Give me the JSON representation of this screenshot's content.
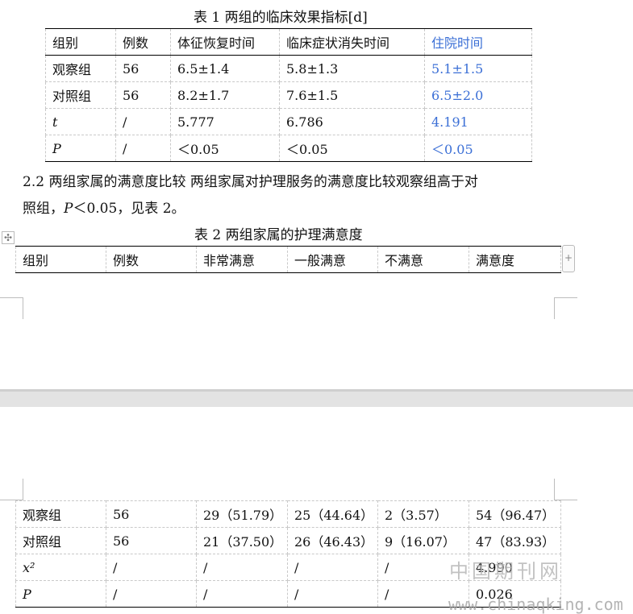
{
  "table1": {
    "caption": "表 1  两组的临床效果指标[d]",
    "header": [
      "组别",
      "例数",
      "体征恢复时间",
      "临床症状消失时间",
      "住院时间"
    ],
    "rows": [
      [
        "观察组",
        "56",
        "6.5±1.4",
        "5.8±1.3",
        "5.1±1.5"
      ],
      [
        "对照组",
        "56",
        "8.2±1.7",
        "7.6±1.5",
        "6.5±2.0"
      ],
      [
        "t",
        "/",
        "5.777",
        "6.786",
        "4.191"
      ],
      [
        "P",
        "/",
        "＜0.05",
        "＜0.05",
        "＜0.05"
      ]
    ]
  },
  "section": {
    "line1": "2.2  两组家属的满意度比较    两组家属对护理服务的满意度比较观察组高于对",
    "line2_prefix": "照组，",
    "line2_italic": "P",
    "line2_suffix": "＜0.05，见表 2。"
  },
  "table2": {
    "caption": "表 2  两组家属的护理满意度",
    "header": [
      "组别",
      "例数",
      "非常满意",
      "一般满意",
      "不满意",
      "满意度"
    ],
    "rows": [
      [
        "观察组",
        "56",
        "29（51.79）",
        "25（44.64）",
        "2（3.57）",
        "54（96.47）"
      ],
      [
        "对照组",
        "56",
        "21（37.50）",
        "26（46.43）",
        "9（16.07）",
        "47（83.93）"
      ],
      [
        "x²",
        "/",
        "/",
        "/",
        "/",
        "4.990"
      ],
      [
        "P",
        "/",
        "/",
        "/",
        "/",
        "0.026"
      ]
    ]
  },
  "ui": {
    "move_handle": "✣",
    "add_column": "+"
  },
  "watermark": {
    "cn": "中国期刊网",
    "url": "www.chinaqking.com"
  },
  "colors": {
    "accent_blue": "#3b6fd6"
  }
}
